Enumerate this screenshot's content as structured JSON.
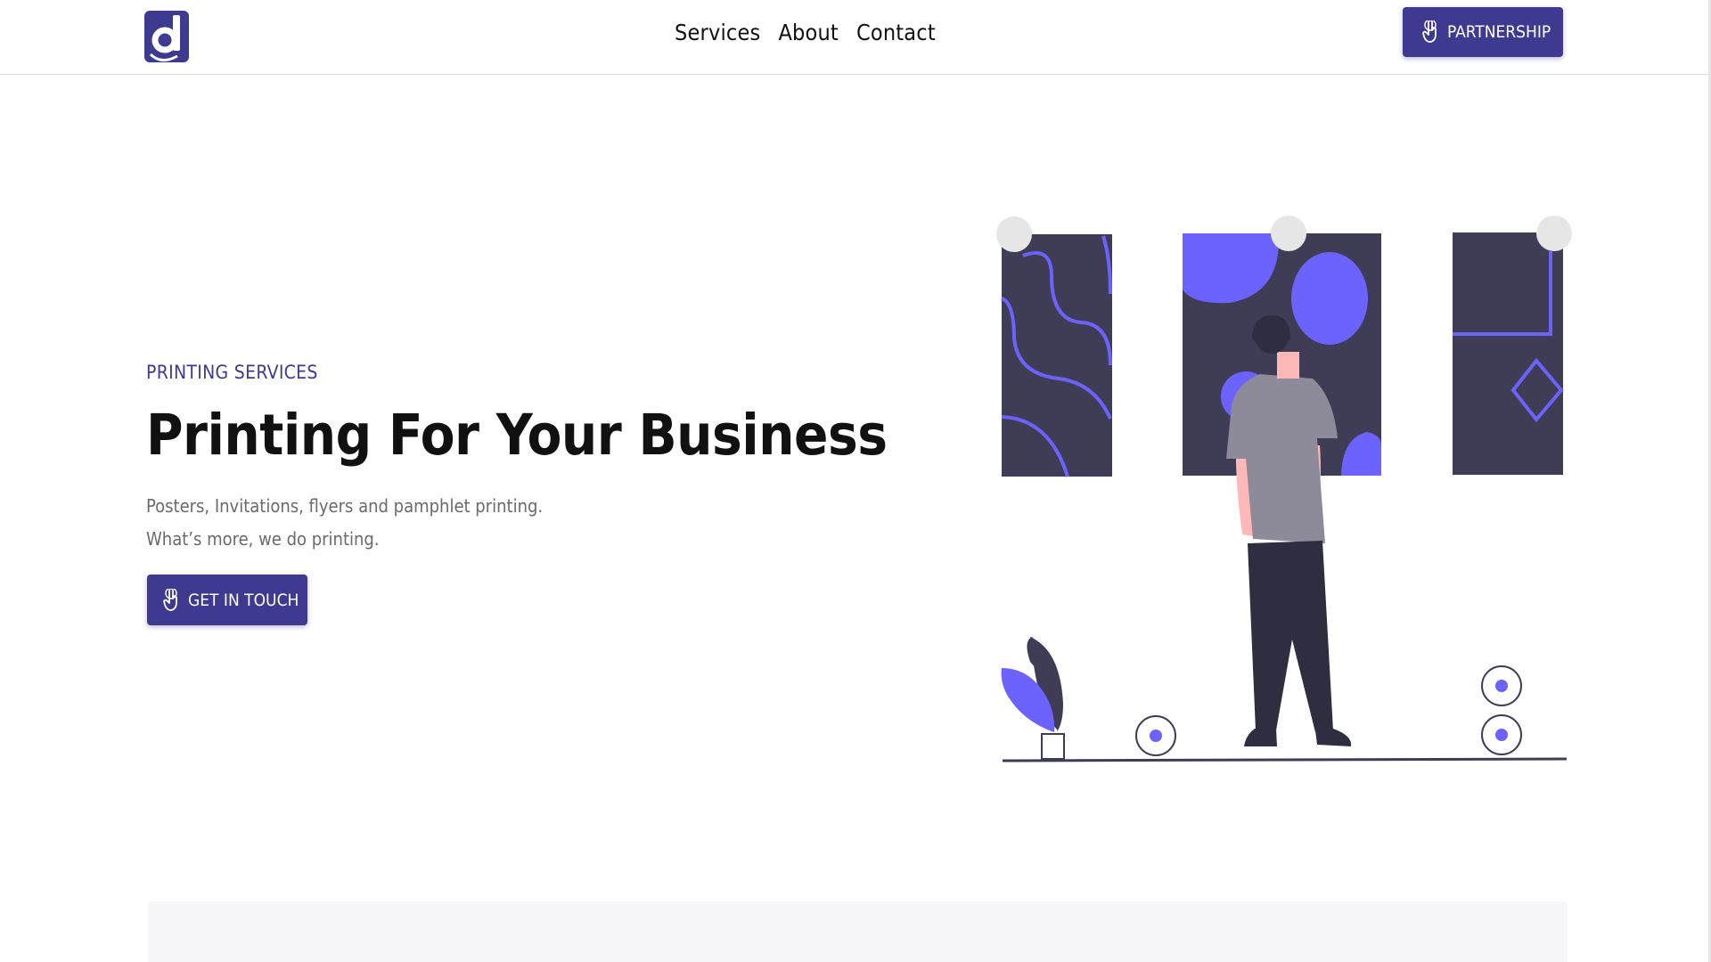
{
  "header": {
    "logo_icon": "d-logo-icon",
    "nav": [
      {
        "label": "Services"
      },
      {
        "label": "About"
      },
      {
        "label": "Contact"
      }
    ],
    "partnership_button": {
      "label": "PARTNERSHIP",
      "icon": "pointer-hand-icon"
    }
  },
  "hero": {
    "eyebrow": "PRINTING SERVICES",
    "title": "Printing For Your Business",
    "subtitle_line1": "Posters, Invitations, flyers and pamphlet printing.",
    "subtitle_line2": "What’s more, we do printing.",
    "cta_button": {
      "label": "GET IN TOUCH",
      "icon": "pointer-hand-icon"
    }
  },
  "colors": {
    "brand": "#3d3a8f",
    "accent_purple": "#6c63ff",
    "dark_panel": "#3f3d56",
    "text": "#111111",
    "muted_text": "#6a6a6a"
  }
}
